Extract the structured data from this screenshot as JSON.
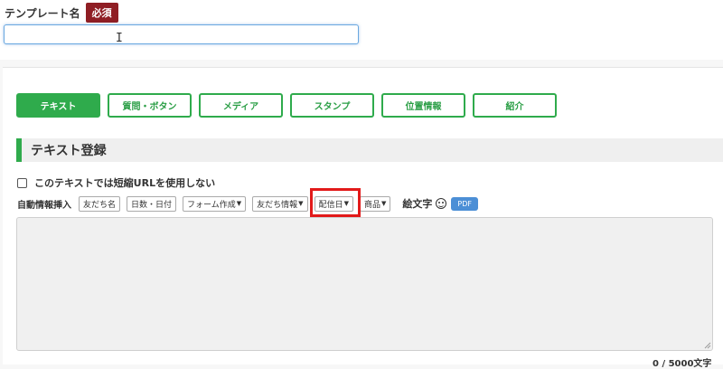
{
  "template_name": {
    "label": "テンプレート名",
    "required_badge": "必須",
    "value": ""
  },
  "tabs": [
    {
      "label": "テキスト",
      "active": true
    },
    {
      "label": "質問・ボタン",
      "active": false
    },
    {
      "label": "メディア",
      "active": false
    },
    {
      "label": "スタンプ",
      "active": false
    },
    {
      "label": "位置情報",
      "active": false
    },
    {
      "label": "紹介",
      "active": false
    }
  ],
  "section": {
    "title": "テキスト登録"
  },
  "short_url": {
    "label": "このテキストでは短縮URLを使用しない",
    "checked": false
  },
  "toolbar": {
    "label": "自動情報挿入",
    "buttons": [
      {
        "label": "友だち名",
        "dropdown": false
      },
      {
        "label": "日数・日付",
        "dropdown": false
      },
      {
        "label": "フォーム作成",
        "dropdown": true
      },
      {
        "label": "友だち情報",
        "dropdown": true
      },
      {
        "label": "配信日",
        "dropdown": true
      },
      {
        "label": "商品",
        "dropdown": true
      }
    ],
    "emoji_label": "絵文字",
    "emoji_icon": "smiley-icon",
    "pdf_label": "PDF"
  },
  "message": {
    "value": "",
    "counter": "0 / 5000文字"
  },
  "colors": {
    "accent_green": "#2fab4c",
    "required_red": "#8f1e24",
    "highlight_red": "#e21a1a",
    "pdf_blue": "#4c8fd6"
  }
}
